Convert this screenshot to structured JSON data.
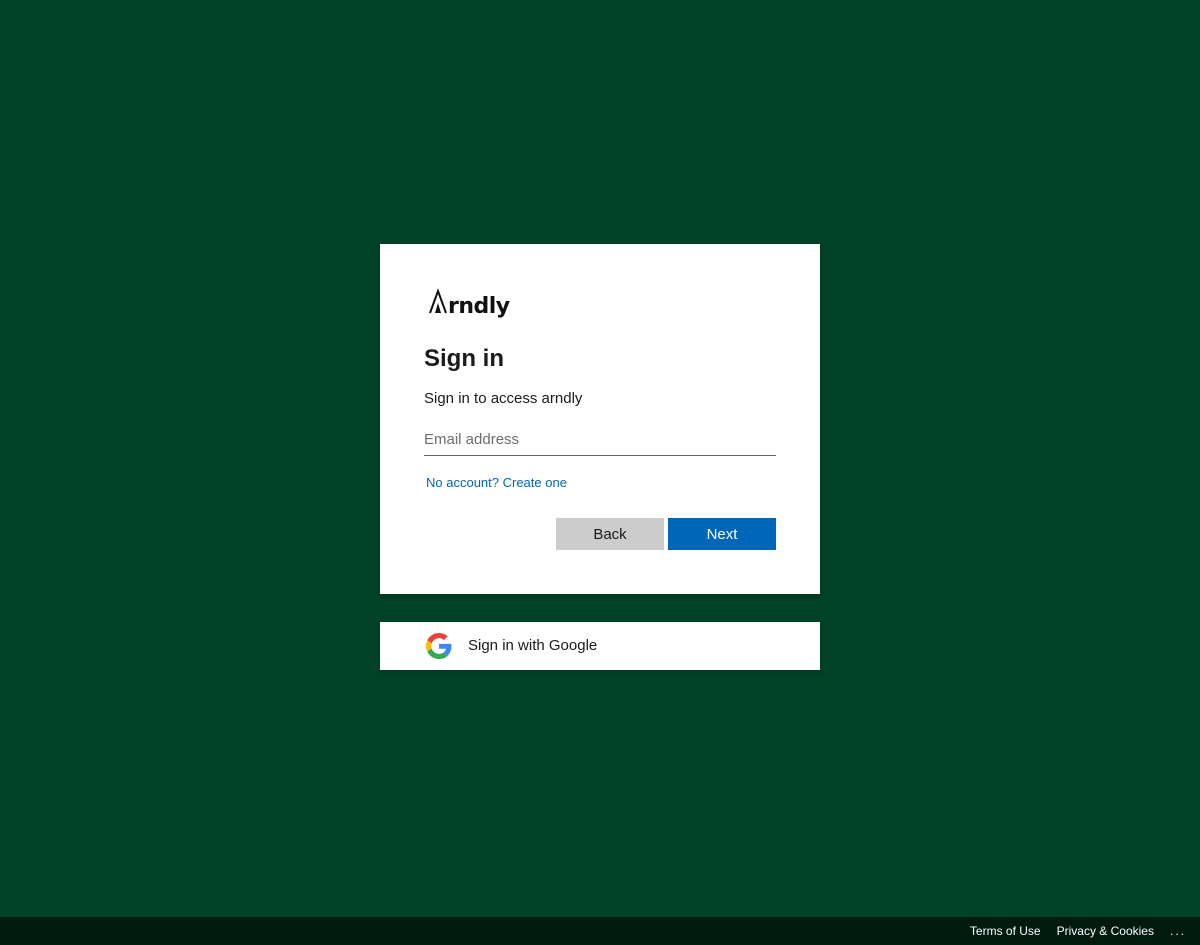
{
  "colors": {
    "background": "#004227",
    "link": "#0067b8",
    "primary_button": "#0067b8",
    "secondary_button": "#cccccc"
  },
  "signin": {
    "logo_text": "arndly",
    "title": "Sign in",
    "subtitle": "Sign in to access arndly",
    "email_value": "",
    "email_placeholder": "Email address",
    "create_account_link": "No account? Create one",
    "back_label": "Back",
    "next_label": "Next"
  },
  "google": {
    "icon": "google-icon",
    "label": "Sign in with Google"
  },
  "footer": {
    "terms": "Terms of Use",
    "privacy": "Privacy & Cookies",
    "more": "..."
  }
}
